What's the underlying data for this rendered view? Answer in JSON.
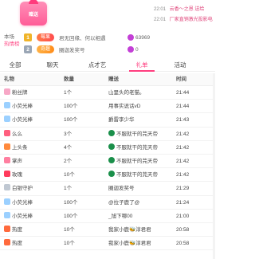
{
  "top": {
    "badge_text": "赠送",
    "notices": [
      {
        "time": "22:01",
        "text": "云香～之恩 送给"
      },
      {
        "time": "22:01",
        "text": "厂家直销激光投影电"
      }
    ]
  },
  "rank": {
    "label_line1": "本场",
    "label_line2": "热",
    "label_line3": "情",
    "label_line4": "榜",
    "rows": [
      {
        "num": "1",
        "chip": "莓果",
        "name": "君无回缘、何以相遇",
        "score": "63969"
      },
      {
        "num": "2",
        "chip": "奇趣",
        "name": "圈迦发奖号",
        "score": "0"
      }
    ]
  },
  "tabs": [
    {
      "label": "全部",
      "active": false
    },
    {
      "label": "聊天",
      "active": false
    },
    {
      "label": "点才艺",
      "active": false
    },
    {
      "label": "礼单",
      "active": true
    },
    {
      "label": "活动",
      "active": false
    }
  ],
  "table": {
    "headers": {
      "gift": "礼物",
      "count": "数量",
      "sender": "赠送",
      "time": "时间"
    },
    "rows": [
      {
        "gift": "粉丝牌",
        "gift_color": "#f7a7c6",
        "count": "1个",
        "sender": "山里头的老猫。",
        "sender_icon": false,
        "time": "21:44"
      },
      {
        "gift": "小荧光棒",
        "gift_color": "#9bd0ff",
        "count": "100个",
        "sender": "用事实说话vD",
        "sender_icon": false,
        "time": "21:44"
      },
      {
        "gift": "小荧光棒",
        "gift_color": "#9bd0ff",
        "count": "100个",
        "sender": "爵雷李少华",
        "sender_icon": false,
        "time": "21:43"
      },
      {
        "gift": "么么",
        "gift_color": "#ff5f7e",
        "count": "3个",
        "sender": "不服就干的芫天帝",
        "sender_icon": true,
        "time": "21:42"
      },
      {
        "gift": "上头条",
        "gift_color": "#ff8a3d",
        "count": "4个",
        "sender": "不服就干的芫天帝",
        "sender_icon": true,
        "time": "21:42"
      },
      {
        "gift": "掌声",
        "gift_color": "#ff7fa0",
        "count": "2个",
        "sender": "不服就干的芫天帝",
        "sender_icon": true,
        "time": "21:42"
      },
      {
        "gift": "玫瑰",
        "gift_color": "#ff3b5c",
        "count": "10个",
        "sender": "不服就干的芫天帝",
        "sender_icon": true,
        "time": "21:42"
      },
      {
        "gift": "白银守护",
        "gift_color": "#c0c8d2",
        "count": "1个",
        "sender": "圈迦发奖号",
        "sender_icon": false,
        "time": "21:29"
      },
      {
        "gift": "小荧光棒",
        "gift_color": "#9bd0ff",
        "count": "100个",
        "sender": "@拉子鹿了@",
        "sender_icon": false,
        "time": "21:24"
      },
      {
        "gift": "小荧光棒",
        "gift_color": "#9bd0ff",
        "count": "100个",
        "sender": "_旭下哪00",
        "sender_icon": false,
        "time": "21:00"
      },
      {
        "gift": "热度",
        "gift_color": "#ff6a3d",
        "count": "10个",
        "sender": "我家小鹿🐝淳君君",
        "sender_icon": false,
        "time": "20:58"
      },
      {
        "gift": "热度",
        "gift_color": "#ff6a3d",
        "count": "10个",
        "sender": "我家小鹿🐝淳君君",
        "sender_icon": false,
        "time": "20:58"
      }
    ]
  }
}
